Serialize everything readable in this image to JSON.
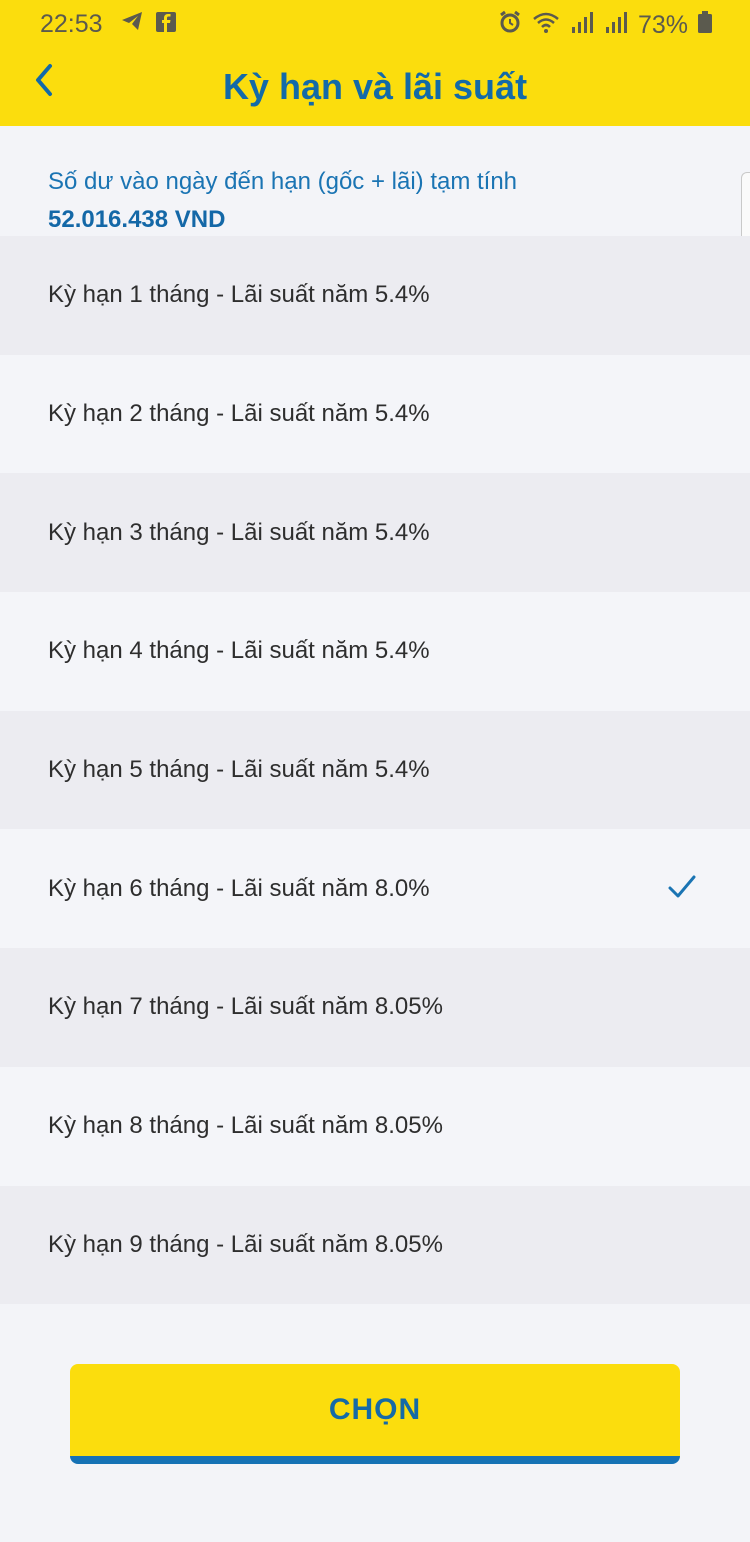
{
  "status": {
    "time": "22:53",
    "battery": "73%",
    "left_icons": [
      "telegram-icon",
      "facebook-icon"
    ],
    "right_icons": [
      "alarm-icon",
      "wifi-icon",
      "signal-icon",
      "signal-icon",
      "battery-icon"
    ]
  },
  "header": {
    "title": "Kỳ hạn và lãi suất",
    "back_icon": "chevron-left-icon"
  },
  "summary": {
    "label": "Số dư vào ngày đến hạn (gốc + lãi) tạm tính",
    "amount": "52.016.438 VND"
  },
  "options": [
    {
      "label": "Kỳ hạn 1 tháng - Lãi suất năm 5.4%",
      "selected": false
    },
    {
      "label": "Kỳ hạn 2 tháng - Lãi suất năm 5.4%",
      "selected": false
    },
    {
      "label": "Kỳ hạn 3 tháng - Lãi suất năm 5.4%",
      "selected": false
    },
    {
      "label": "Kỳ hạn 4 tháng - Lãi suất năm 5.4%",
      "selected": false
    },
    {
      "label": "Kỳ hạn 5 tháng - Lãi suất năm 5.4%",
      "selected": false
    },
    {
      "label": "Kỳ hạn 6 tháng - Lãi suất năm 8.0%",
      "selected": true
    },
    {
      "label": "Kỳ hạn 7 tháng - Lãi suất năm 8.05%",
      "selected": false
    },
    {
      "label": "Kỳ hạn 8 tháng - Lãi suất năm 8.05%",
      "selected": false
    },
    {
      "label": "Kỳ hạn 9 tháng - Lãi suất năm 8.05%",
      "selected": false
    }
  ],
  "button": {
    "label": "CHỌN"
  },
  "colors": {
    "brand_yellow": "#fbdd0d",
    "brand_blue": "#136aa8"
  }
}
